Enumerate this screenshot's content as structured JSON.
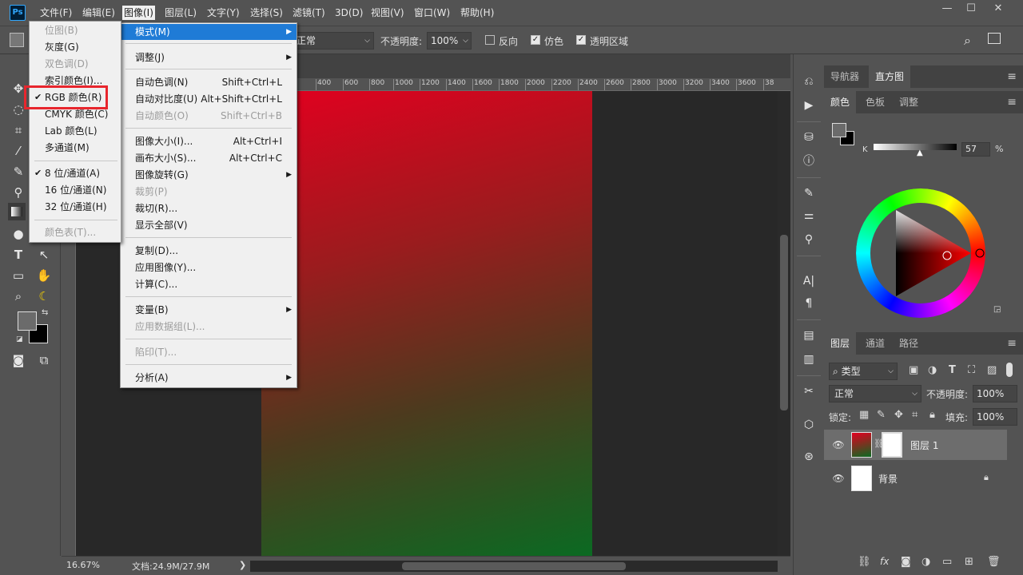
{
  "menubar": {
    "logo": "Ps",
    "items": [
      "文件(F)",
      "编辑(E)",
      "图像(I)",
      "图层(L)",
      "文字(Y)",
      "选择(S)",
      "滤镜(T)",
      "3D(D)",
      "视图(V)",
      "窗口(W)",
      "帮助(H)"
    ],
    "active_index": 2
  },
  "window_controls": {
    "minimize": "—",
    "restore": "☐",
    "close": "✕"
  },
  "options_bar": {
    "mode_value": "正常",
    "opacity_label": "不透明度:",
    "opacity_value": "100%",
    "reverse_label": "反向",
    "dither_label": "仿色",
    "transparency_label": "透明区域"
  },
  "image_menu": {
    "items": [
      {
        "label": "模式(M)",
        "shortcut": "",
        "submenu": true,
        "disabled": false,
        "highlighted": true
      },
      {
        "label": "调整(J)",
        "shortcut": "",
        "submenu": true,
        "disabled": false
      },
      {
        "label": "自动色调(N)",
        "shortcut": "Shift+Ctrl+L",
        "disabled": false
      },
      {
        "label": "自动对比度(U)",
        "shortcut": "Alt+Shift+Ctrl+L",
        "disabled": false
      },
      {
        "label": "自动颜色(O)",
        "shortcut": "Shift+Ctrl+B",
        "disabled": true
      },
      {
        "label": "图像大小(I)...",
        "shortcut": "Alt+Ctrl+I",
        "disabled": false
      },
      {
        "label": "画布大小(S)...",
        "shortcut": "Alt+Ctrl+C",
        "disabled": false
      },
      {
        "label": "图像旋转(G)",
        "shortcut": "",
        "submenu": true,
        "disabled": false
      },
      {
        "label": "裁剪(P)",
        "shortcut": "",
        "disabled": true
      },
      {
        "label": "裁切(R)...",
        "shortcut": "",
        "disabled": false
      },
      {
        "label": "显示全部(V)",
        "shortcut": "",
        "disabled": false
      },
      {
        "label": "复制(D)...",
        "shortcut": "",
        "disabled": false
      },
      {
        "label": "应用图像(Y)...",
        "shortcut": "",
        "disabled": false
      },
      {
        "label": "计算(C)...",
        "shortcut": "",
        "disabled": false
      },
      {
        "label": "变量(B)",
        "shortcut": "",
        "submenu": true,
        "disabled": false
      },
      {
        "label": "应用数据组(L)...",
        "shortcut": "",
        "disabled": true
      },
      {
        "label": "陷印(T)...",
        "shortcut": "",
        "disabled": true
      },
      {
        "label": "分析(A)",
        "shortcut": "",
        "submenu": true,
        "disabled": false
      }
    ]
  },
  "mode_menu": {
    "items": [
      {
        "label": "位图(B)",
        "disabled": true,
        "checked": false
      },
      {
        "label": "灰度(G)",
        "disabled": false,
        "checked": false
      },
      {
        "label": "双色调(D)",
        "disabled": true,
        "checked": false
      },
      {
        "label": "索引颜色(I)...",
        "disabled": false,
        "checked": false
      },
      {
        "label": "RGB 颜色(R)",
        "disabled": false,
        "checked": true
      },
      {
        "label": "CMYK 颜色(C)",
        "disabled": false,
        "checked": false
      },
      {
        "label": "Lab 颜色(L)",
        "disabled": false,
        "checked": false
      },
      {
        "label": "多通道(M)",
        "disabled": false,
        "checked": false
      },
      {
        "label": "8 位/通道(A)",
        "disabled": false,
        "checked": true
      },
      {
        "label": "16 位/通道(N)",
        "disabled": false,
        "checked": false
      },
      {
        "label": "32 位/通道(H)",
        "disabled": false,
        "checked": false
      },
      {
        "label": "颜色表(T)...",
        "disabled": true,
        "checked": false
      }
    ],
    "check_glyph": "✔"
  },
  "ruler": {
    "ticks": [
      "400",
      "600",
      "800",
      "1000",
      "1200",
      "1400",
      "1600",
      "1800",
      "2000",
      "2200",
      "2400",
      "2600",
      "2800",
      "3000",
      "3200",
      "3400",
      "3600",
      "38"
    ]
  },
  "status_bar": {
    "zoom": "16.67%",
    "doc_info": "文档:24.9M/27.9M",
    "arrow": "❯"
  },
  "panels": {
    "top_tabs": [
      "导航器",
      "直方图"
    ],
    "top_active": 1,
    "color_tabs": [
      "颜色",
      "色板",
      "调整"
    ],
    "color_active": 0,
    "k_label": "K",
    "k_value": "57",
    "k_percent": "%",
    "layer_tabs": [
      "图层",
      "通道",
      "路径"
    ],
    "layer_active": 0,
    "filter_kind": "类型",
    "blend_mode": "正常",
    "opacity_label": "不透明度:",
    "opacity_value": "100%",
    "lock_label": "锁定:",
    "fill_label": "填充:",
    "fill_value": "100%",
    "layers": [
      {
        "name": "图层 1",
        "selected": true
      },
      {
        "name": "背景",
        "selected": false
      }
    ]
  },
  "colors": {
    "accent_highlight": "#1f7bd6",
    "callout_red": "#e8262d",
    "foreground": "#6b6b6b",
    "background": "#000000"
  }
}
